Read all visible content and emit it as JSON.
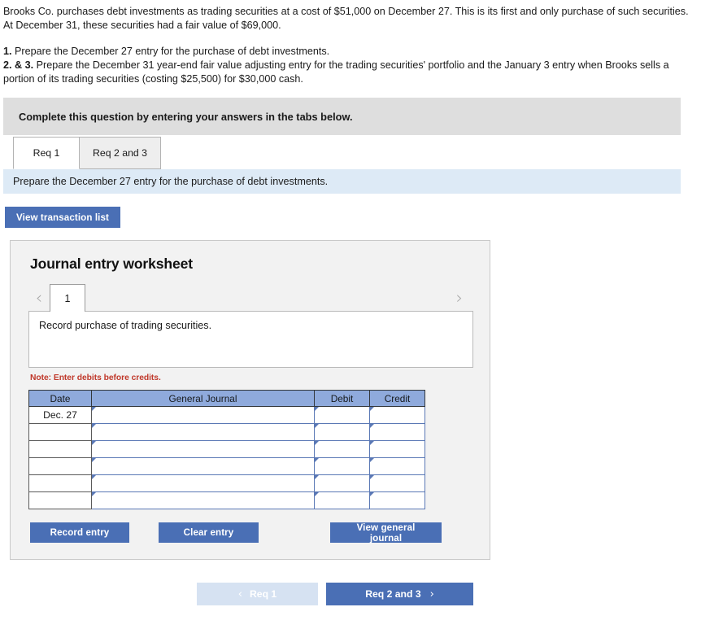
{
  "problem": {
    "paragraph1": "Brooks Co. purchases debt investments as trading securities at a cost of $51,000 on December 27. This is its first and only purchase of such securities. At December 31, these securities had a fair value of $69,000.",
    "req1_number": "1.",
    "req1_text": " Prepare the December 27 entry for the purchase of debt investments.",
    "req23_number": "2. & 3.",
    "req23_text": " Prepare the December 31 year-end fair value adjusting entry for the trading securities' portfolio and the January 3 entry when Brooks sells a portion of its trading securities (costing $25,500) for $30,000 cash."
  },
  "banner": {
    "text": "Complete this question by entering your answers in the tabs below."
  },
  "tabs": [
    {
      "label": "Req 1",
      "active": true
    },
    {
      "label": "Req 2 and 3",
      "active": false
    }
  ],
  "req_bar": {
    "text": "Prepare the December 27 entry for the purchase of debt investments."
  },
  "buttons": {
    "view_transaction_list": "View transaction list",
    "record_entry": "Record entry",
    "clear_entry": "Clear entry",
    "view_general_journal": "View general journal"
  },
  "worksheet": {
    "title": "Journal entry worksheet",
    "pager": {
      "prev_icon": "‹",
      "next_icon": "›",
      "current_page": "1"
    },
    "entry_description": "Record purchase of trading securities.",
    "note": "Note: Enter debits before credits."
  },
  "journal_table": {
    "headers": [
      "Date",
      "General Journal",
      "Debit",
      "Credit"
    ],
    "rows": [
      {
        "date": "Dec. 27",
        "general_journal": "",
        "debit": "",
        "credit": ""
      },
      {
        "date": "",
        "general_journal": "",
        "debit": "",
        "credit": ""
      },
      {
        "date": "",
        "general_journal": "",
        "debit": "",
        "credit": ""
      },
      {
        "date": "",
        "general_journal": "",
        "debit": "",
        "credit": ""
      },
      {
        "date": "",
        "general_journal": "",
        "debit": "",
        "credit": ""
      },
      {
        "date": "",
        "general_journal": "",
        "debit": "",
        "credit": ""
      }
    ]
  },
  "bottom_nav": {
    "prev_label": "Req 1",
    "prev_chevron": "‹",
    "next_label": "Req 2 and 3",
    "next_chevron": "›"
  },
  "colors": {
    "accent_blue": "#4a6fb5",
    "table_header_blue": "#8faadc",
    "req_bar_blue": "#ddeaf6",
    "banner_gray": "#dedede",
    "note_red": "#c0392b",
    "disabled_blue": "#d6e2f2"
  }
}
